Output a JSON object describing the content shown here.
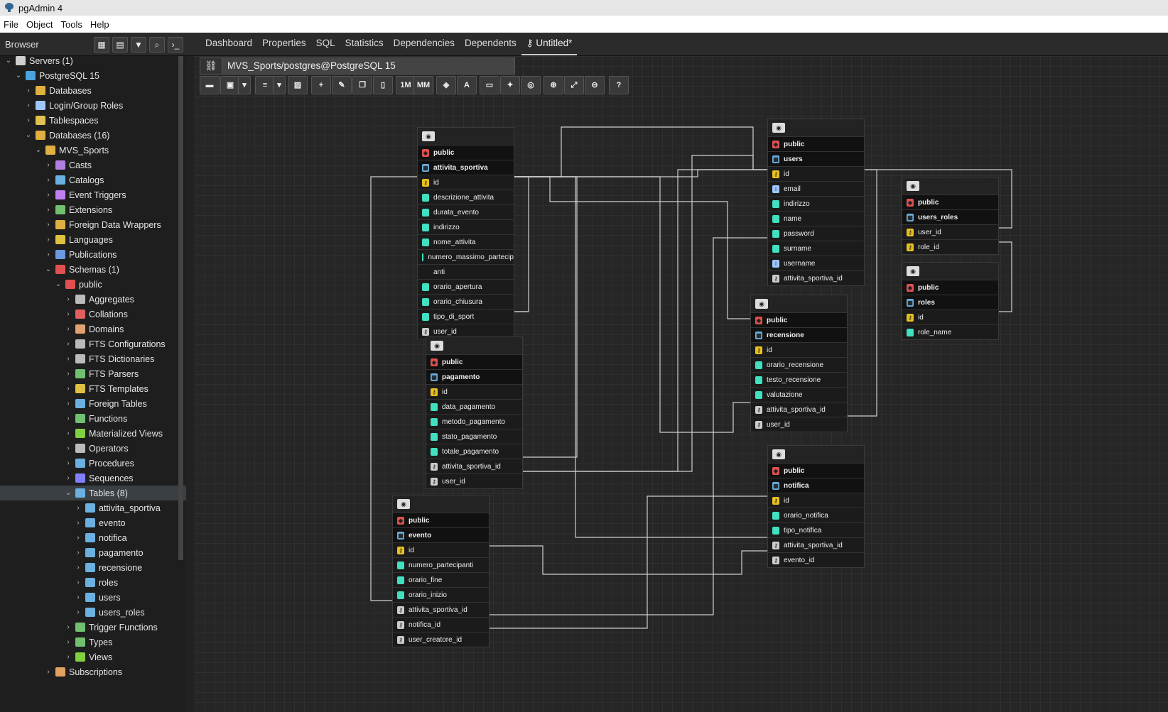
{
  "window": {
    "title": "pgAdmin 4"
  },
  "menu": [
    "File",
    "Object",
    "Tools",
    "Help"
  ],
  "browser_label": "Browser",
  "tabs": [
    "Dashboard",
    "Properties",
    "SQL",
    "Statistics",
    "Dependencies",
    "Dependents",
    "Untitled*"
  ],
  "erd_path": "MVS_Sports/postgres@PostgreSQL 15",
  "toolbar_text": {
    "one_m": "1M",
    "mm": "MM"
  },
  "tree": [
    {
      "label": "Servers (1)",
      "depth": 0,
      "open": true,
      "icon": "server-icon",
      "color": "#cfcfcf"
    },
    {
      "label": "PostgreSQL 15",
      "depth": 1,
      "open": true,
      "icon": "elephant-icon",
      "color": "#4aa3df"
    },
    {
      "label": "Databases",
      "depth": 2,
      "open": false,
      "icon": "database-icon",
      "color": "#e0b040"
    },
    {
      "label": "Login/Group Roles",
      "depth": 2,
      "open": false,
      "icon": "roles-icon",
      "color": "#9ec7ff"
    },
    {
      "label": "Tablespaces",
      "depth": 2,
      "open": false,
      "icon": "folder-icon",
      "color": "#e0c050"
    },
    {
      "label": "Databases (16)",
      "depth": 2,
      "open": true,
      "icon": "database-icon",
      "color": "#e0b040"
    },
    {
      "label": "MVS_Sports",
      "depth": 3,
      "open": true,
      "icon": "database-icon",
      "color": "#e0b040"
    },
    {
      "label": "Casts",
      "depth": 4,
      "open": false,
      "icon": "cast-icon",
      "color": "#b080e0"
    },
    {
      "label": "Catalogs",
      "depth": 4,
      "open": false,
      "icon": "catalog-icon",
      "color": "#6ab0e0"
    },
    {
      "label": "Event Triggers",
      "depth": 4,
      "open": false,
      "icon": "event-trigger-icon",
      "color": "#c080f0"
    },
    {
      "label": "Extensions",
      "depth": 4,
      "open": false,
      "icon": "extension-icon",
      "color": "#70c070"
    },
    {
      "label": "Foreign Data Wrappers",
      "depth": 4,
      "open": false,
      "icon": "fdw-icon",
      "color": "#e0b040"
    },
    {
      "label": "Languages",
      "depth": 4,
      "open": false,
      "icon": "language-icon",
      "color": "#e0c040"
    },
    {
      "label": "Publications",
      "depth": 4,
      "open": false,
      "icon": "publication-icon",
      "color": "#6a9ae0"
    },
    {
      "label": "Schemas (1)",
      "depth": 4,
      "open": true,
      "icon": "schemas-icon",
      "color": "#e05050"
    },
    {
      "label": "public",
      "depth": 5,
      "open": true,
      "icon": "schema-icon",
      "color": "#e05050"
    },
    {
      "label": "Aggregates",
      "depth": 6,
      "open": false,
      "icon": "aggregate-icon",
      "color": "#bbbbbb"
    },
    {
      "label": "Collations",
      "depth": 6,
      "open": false,
      "icon": "collation-icon",
      "color": "#e06060"
    },
    {
      "label": "Domains",
      "depth": 6,
      "open": false,
      "icon": "domain-icon",
      "color": "#e0a070"
    },
    {
      "label": "FTS Configurations",
      "depth": 6,
      "open": false,
      "icon": "fts-config-icon",
      "color": "#bbbbbb"
    },
    {
      "label": "FTS Dictionaries",
      "depth": 6,
      "open": false,
      "icon": "fts-dict-icon",
      "color": "#bbbbbb"
    },
    {
      "label": "FTS Parsers",
      "depth": 6,
      "open": false,
      "icon": "fts-parser-icon",
      "color": "#70c070"
    },
    {
      "label": "FTS Templates",
      "depth": 6,
      "open": false,
      "icon": "fts-template-icon",
      "color": "#e0c040"
    },
    {
      "label": "Foreign Tables",
      "depth": 6,
      "open": false,
      "icon": "foreign-table-icon",
      "color": "#6ab0e0"
    },
    {
      "label": "Functions",
      "depth": 6,
      "open": false,
      "icon": "function-icon",
      "color": "#70c070"
    },
    {
      "label": "Materialized Views",
      "depth": 6,
      "open": false,
      "icon": "mview-icon",
      "color": "#80d040"
    },
    {
      "label": "Operators",
      "depth": 6,
      "open": false,
      "icon": "operator-icon",
      "color": "#bbbbbb"
    },
    {
      "label": "Procedures",
      "depth": 6,
      "open": false,
      "icon": "procedure-icon",
      "color": "#6ab0e0"
    },
    {
      "label": "Sequences",
      "depth": 6,
      "open": false,
      "icon": "sequence-icon",
      "color": "#8080ff"
    },
    {
      "label": "Tables (8)",
      "depth": 6,
      "open": true,
      "icon": "tables-icon",
      "color": "#6ab0e0",
      "selected": true
    },
    {
      "label": "attivita_sportiva",
      "depth": 7,
      "open": false,
      "icon": "table-icon",
      "color": "#6ab0e0"
    },
    {
      "label": "evento",
      "depth": 7,
      "open": false,
      "icon": "table-icon",
      "color": "#6ab0e0"
    },
    {
      "label": "notifica",
      "depth": 7,
      "open": false,
      "icon": "table-icon",
      "color": "#6ab0e0"
    },
    {
      "label": "pagamento",
      "depth": 7,
      "open": false,
      "icon": "table-icon",
      "color": "#6ab0e0"
    },
    {
      "label": "recensione",
      "depth": 7,
      "open": false,
      "icon": "table-icon",
      "color": "#6ab0e0"
    },
    {
      "label": "roles",
      "depth": 7,
      "open": false,
      "icon": "table-icon",
      "color": "#6ab0e0"
    },
    {
      "label": "users",
      "depth": 7,
      "open": false,
      "icon": "table-icon",
      "color": "#6ab0e0"
    },
    {
      "label": "users_roles",
      "depth": 7,
      "open": false,
      "icon": "table-icon",
      "color": "#6ab0e0"
    },
    {
      "label": "Trigger Functions",
      "depth": 6,
      "open": false,
      "icon": "trigger-function-icon",
      "color": "#70c070"
    },
    {
      "label": "Types",
      "depth": 6,
      "open": false,
      "icon": "type-icon",
      "color": "#70c070"
    },
    {
      "label": "Views",
      "depth": 6,
      "open": false,
      "icon": "view-icon",
      "color": "#80d040"
    },
    {
      "label": "Subscriptions",
      "depth": 4,
      "open": false,
      "icon": "subscription-icon",
      "color": "#e0a060"
    }
  ],
  "tables": [
    {
      "id": "attivita_sportiva",
      "schema": "public",
      "name": "attivita_sportiva",
      "columns": [
        {
          "name": "id",
          "kind": "pk"
        },
        {
          "name": "descrizione_attivita",
          "kind": "col"
        },
        {
          "name": "durata_evento",
          "kind": "col"
        },
        {
          "name": "indirizzo",
          "kind": "col"
        },
        {
          "name": "nome_attivita",
          "kind": "col"
        },
        {
          "name": "numero_massimo_partecip",
          "kind": "col"
        },
        {
          "name": "anti",
          "kind": "wrap"
        },
        {
          "name": "orario_apertura",
          "kind": "col"
        },
        {
          "name": "orario_chiusura",
          "kind": "col"
        },
        {
          "name": "tipo_di_sport",
          "kind": "col"
        },
        {
          "name": "user_id",
          "kind": "fk"
        }
      ]
    },
    {
      "id": "users",
      "schema": "public",
      "name": "users",
      "columns": [
        {
          "name": "id",
          "kind": "pk"
        },
        {
          "name": "email",
          "kind": "uniq"
        },
        {
          "name": "indirizzo",
          "kind": "col"
        },
        {
          "name": "name",
          "kind": "col"
        },
        {
          "name": "password",
          "kind": "col"
        },
        {
          "name": "surname",
          "kind": "col"
        },
        {
          "name": "username",
          "kind": "uniq"
        },
        {
          "name": "attivita_sportiva_id",
          "kind": "fk"
        }
      ]
    },
    {
      "id": "users_roles",
      "schema": "public",
      "name": "users_roles",
      "columns": [
        {
          "name": "user_id",
          "kind": "pk"
        },
        {
          "name": "role_id",
          "kind": "pk"
        }
      ]
    },
    {
      "id": "roles",
      "schema": "public",
      "name": "roles",
      "columns": [
        {
          "name": "id",
          "kind": "pk"
        },
        {
          "name": "role_name",
          "kind": "col"
        }
      ]
    },
    {
      "id": "recensione",
      "schema": "public",
      "name": "recensione",
      "columns": [
        {
          "name": "id",
          "kind": "pk"
        },
        {
          "name": "orario_recensione",
          "kind": "col"
        },
        {
          "name": "testo_recensione",
          "kind": "col"
        },
        {
          "name": "valutazione",
          "kind": "col"
        },
        {
          "name": "attivita_sportiva_id",
          "kind": "fk"
        },
        {
          "name": "user_id",
          "kind": "fk"
        }
      ]
    },
    {
      "id": "pagamento",
      "schema": "public",
      "name": "pagamento",
      "columns": [
        {
          "name": "id",
          "kind": "pk"
        },
        {
          "name": "data_pagamento",
          "kind": "col"
        },
        {
          "name": "metodo_pagamento",
          "kind": "col"
        },
        {
          "name": "stato_pagamento",
          "kind": "col"
        },
        {
          "name": "totale_pagamento",
          "kind": "col"
        },
        {
          "name": "attivita_sportiva_id",
          "kind": "fk"
        },
        {
          "name": "user_id",
          "kind": "fk"
        }
      ]
    },
    {
      "id": "notifica",
      "schema": "public",
      "name": "notifica",
      "columns": [
        {
          "name": "id",
          "kind": "pk"
        },
        {
          "name": "orario_notifica",
          "kind": "col"
        },
        {
          "name": "tipo_notifica",
          "kind": "col"
        },
        {
          "name": "attivita_sportiva_id",
          "kind": "fk"
        },
        {
          "name": "evento_id",
          "kind": "fk"
        }
      ]
    },
    {
      "id": "evento",
      "schema": "public",
      "name": "evento",
      "columns": [
        {
          "name": "id",
          "kind": "pk"
        },
        {
          "name": "numero_partecipanti",
          "kind": "col"
        },
        {
          "name": "orario_fine",
          "kind": "col"
        },
        {
          "name": "orario_inizio",
          "kind": "col"
        },
        {
          "name": "attivita_sportiva_id",
          "kind": "fk"
        },
        {
          "name": "notifica_id",
          "kind": "fk"
        },
        {
          "name": "user_creatore_id",
          "kind": "fk"
        }
      ]
    }
  ],
  "colors": {
    "pk": "#e8c020",
    "fk": "#cccccc",
    "col": "#40e0c0",
    "uniq": "#9ec7ff",
    "link": "#cfcfcf"
  }
}
